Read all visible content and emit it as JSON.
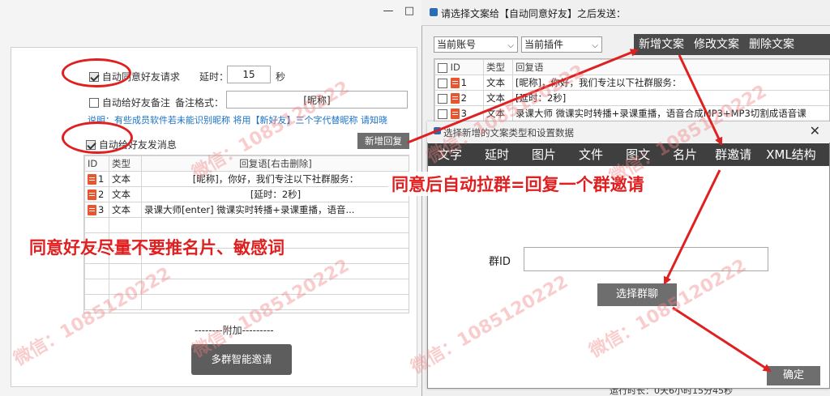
{
  "left": {
    "win_min": "—",
    "win_max": "□",
    "auto_accept_label": "自动同意好友请求",
    "delay_label": "延时：",
    "delay_value": "15",
    "delay_unit": "秒",
    "auto_remark_label": "自动给好友备注",
    "remark_format_label": "备注格式：",
    "remark_format_value": "[昵称]",
    "note_text": "说明：有些成员软件若未能识别昵称 将用【新好友】三个字代替昵称 请知晓",
    "auto_msg_label": "自动给好友发消息",
    "add_reply_button": "新增回复",
    "table_headers": [
      "ID",
      "类型",
      "回复语[右击删除]"
    ],
    "rows": [
      {
        "id": "1",
        "type": "文本",
        "content": "[昵称]，你好，我们专注以下社群服务："
      },
      {
        "id": "2",
        "type": "文本",
        "content": "[延时：2秒]"
      },
      {
        "id": "3",
        "type": "文本",
        "content": "录课大师[enter]  微课实时转播+录课重播，语音..."
      }
    ],
    "addon_divider": "--------附加---------",
    "multi_group_button": "多群智能邀请"
  },
  "right": {
    "title": "请选择文案给【自动同意好友】之后发送：",
    "account_select": "当前账号",
    "plugin_select": "当前插件",
    "toolbar": [
      "新增文案",
      "修改文案",
      "删除文案"
    ],
    "table_headers": [
      "ID",
      "类型",
      "回复语"
    ],
    "rows": [
      {
        "id": "1",
        "type": "文本",
        "content": "[昵称]，你好，我们专注以下社群服务："
      },
      {
        "id": "2",
        "type": "文本",
        "content": "[延时：2秒]"
      },
      {
        "id": "3",
        "type": "文本",
        "content": "录课大师  微课实时转播+录课重播，语音合成MP3+MP3切割成语音课"
      }
    ],
    "runtime": "运行时长：0天6小时15分45秒"
  },
  "dialog": {
    "title": "选择新增的文案类型和设置数据",
    "close": "✕",
    "toolbar": [
      "文字",
      "延时",
      "图片",
      "文件",
      "图文",
      "名片",
      "群邀请",
      "XML结构"
    ],
    "group_id_label": "群ID",
    "group_id_value": "",
    "select_group_button": "选择群聊",
    "confirm_button": "确定"
  },
  "annotations": {
    "left_note": "同意好友尽量不要推名片、敏感词",
    "right_note": "同意后自动拉群=回复一个群邀请",
    "watermark": "微信：1085120222"
  },
  "colors": {
    "annotation_red": "#e02020",
    "link_blue": "#1a73c8",
    "button_gray": "#6e6e6e",
    "toolbar_dark": "#3f3f3f"
  }
}
